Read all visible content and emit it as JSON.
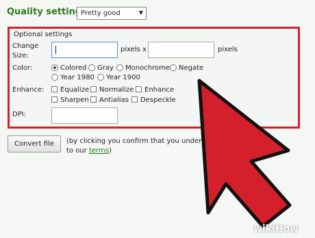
{
  "quality": {
    "label": "Quality settings:",
    "selected": "Pretty good"
  },
  "optional": {
    "title": "Optional settings",
    "change_size": {
      "label_line1": "Change",
      "label_line2": "Size:",
      "unit_x": "pixels x",
      "unit": "pixels"
    },
    "color": {
      "label": "Color:",
      "options": [
        "Colored",
        "Gray",
        "Monochrome",
        "Negate",
        "Year 1980",
        "Year 1900"
      ],
      "selected": "Colored"
    },
    "enhance": {
      "label": "Enhance:",
      "options": [
        "Equalize",
        "Normalize",
        "Enhance",
        "Sharpen",
        "Antialias",
        "Despeckle"
      ]
    },
    "dpi": {
      "label": "DPI:"
    }
  },
  "convert": {
    "button": "Convert file",
    "note_line1": "(by clicking you confirm that you unders",
    "note_line2_prefix": "to our ",
    "terms_link": "terms",
    "note_line2_suffix": ")"
  },
  "watermark": {
    "wiki": "wiki",
    "how": "How"
  },
  "colors": {
    "accent": "#2f7a1f",
    "highlight": "#d4202c"
  }
}
